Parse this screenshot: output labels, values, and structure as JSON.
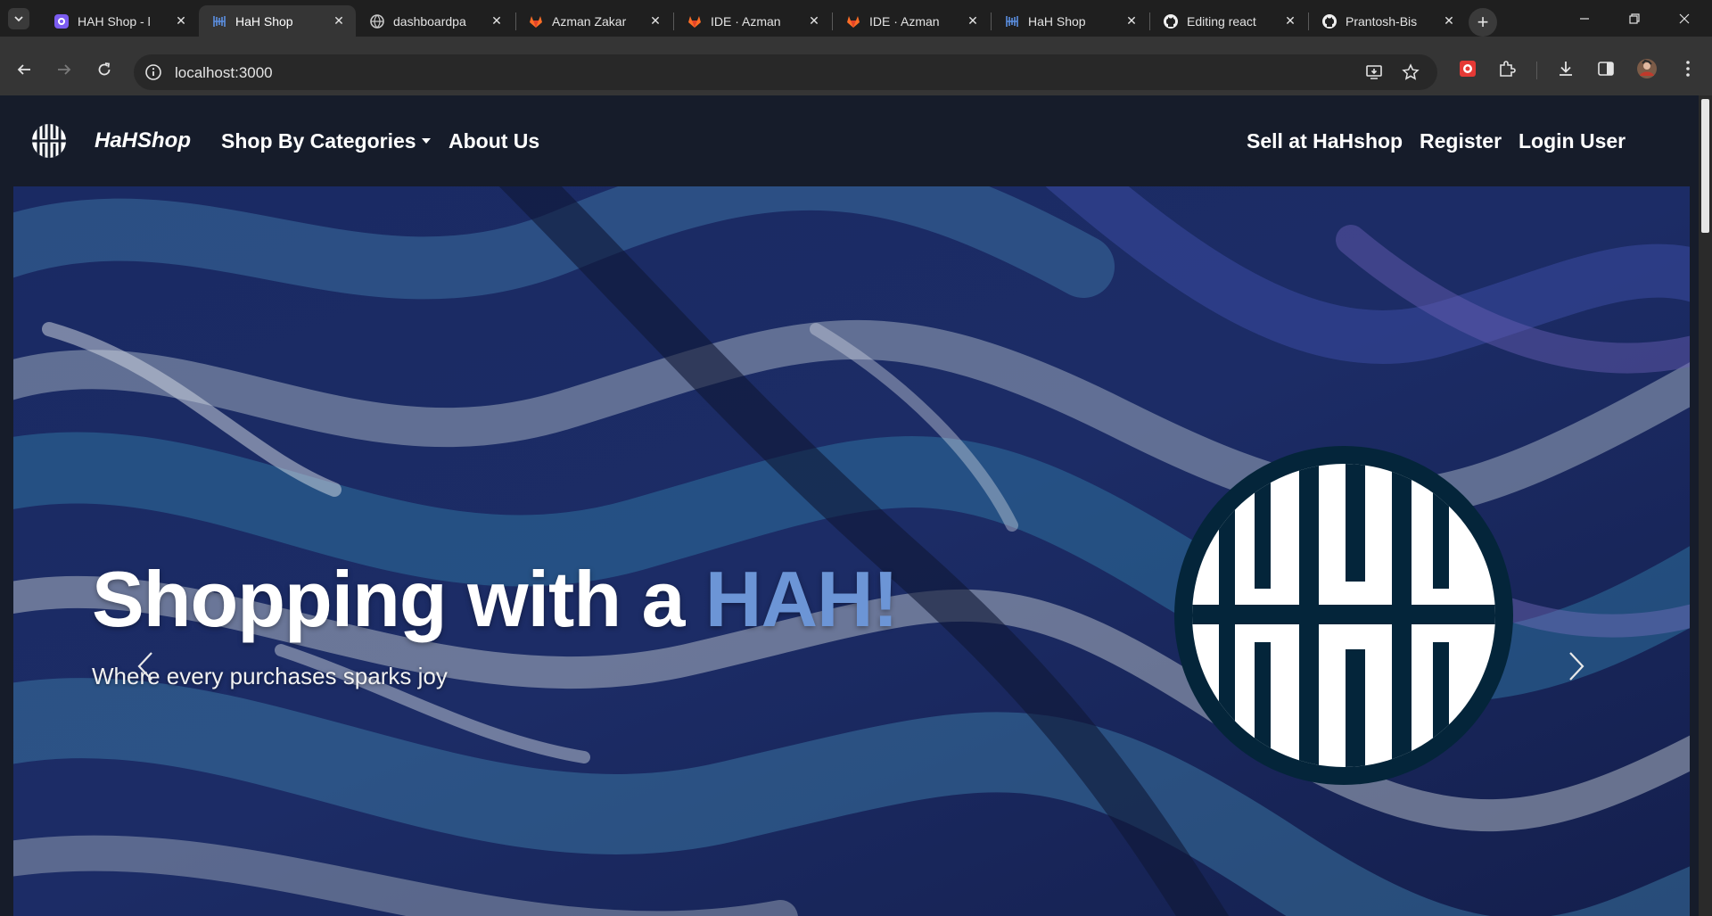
{
  "browser": {
    "tabs": [
      {
        "title": "HAH Shop - l",
        "icon": "purple-app-icon"
      },
      {
        "title": "HaH Shop",
        "icon": "hah-shop-icon",
        "active": true
      },
      {
        "title": "dashboardpa",
        "icon": "globe-icon"
      },
      {
        "title": "Azman Zakar",
        "icon": "gitlab-icon"
      },
      {
        "title": "IDE · Azman",
        "icon": "gitlab-icon"
      },
      {
        "title": "IDE · Azman",
        "icon": "gitlab-icon"
      },
      {
        "title": "HaH Shop",
        "icon": "hah-shop-icon"
      },
      {
        "title": "Editing react",
        "icon": "github-icon"
      },
      {
        "title": "Prantosh-Bis",
        "icon": "github-icon"
      }
    ],
    "url": "localhost:3000"
  },
  "site": {
    "brand": "HaHShop",
    "nav_left": [
      "Shop By Categories",
      "About Us"
    ],
    "nav_right": [
      "Sell at HaHshop",
      "Register",
      "Login User"
    ]
  },
  "hero": {
    "title_main": "Shopping with a ",
    "title_accent": "HAH!",
    "subtitle": "Where every purchases sparks joy"
  },
  "colors": {
    "page_bg": "#161c2a",
    "accent": "#6c95d6",
    "emblem": "#04253a"
  }
}
